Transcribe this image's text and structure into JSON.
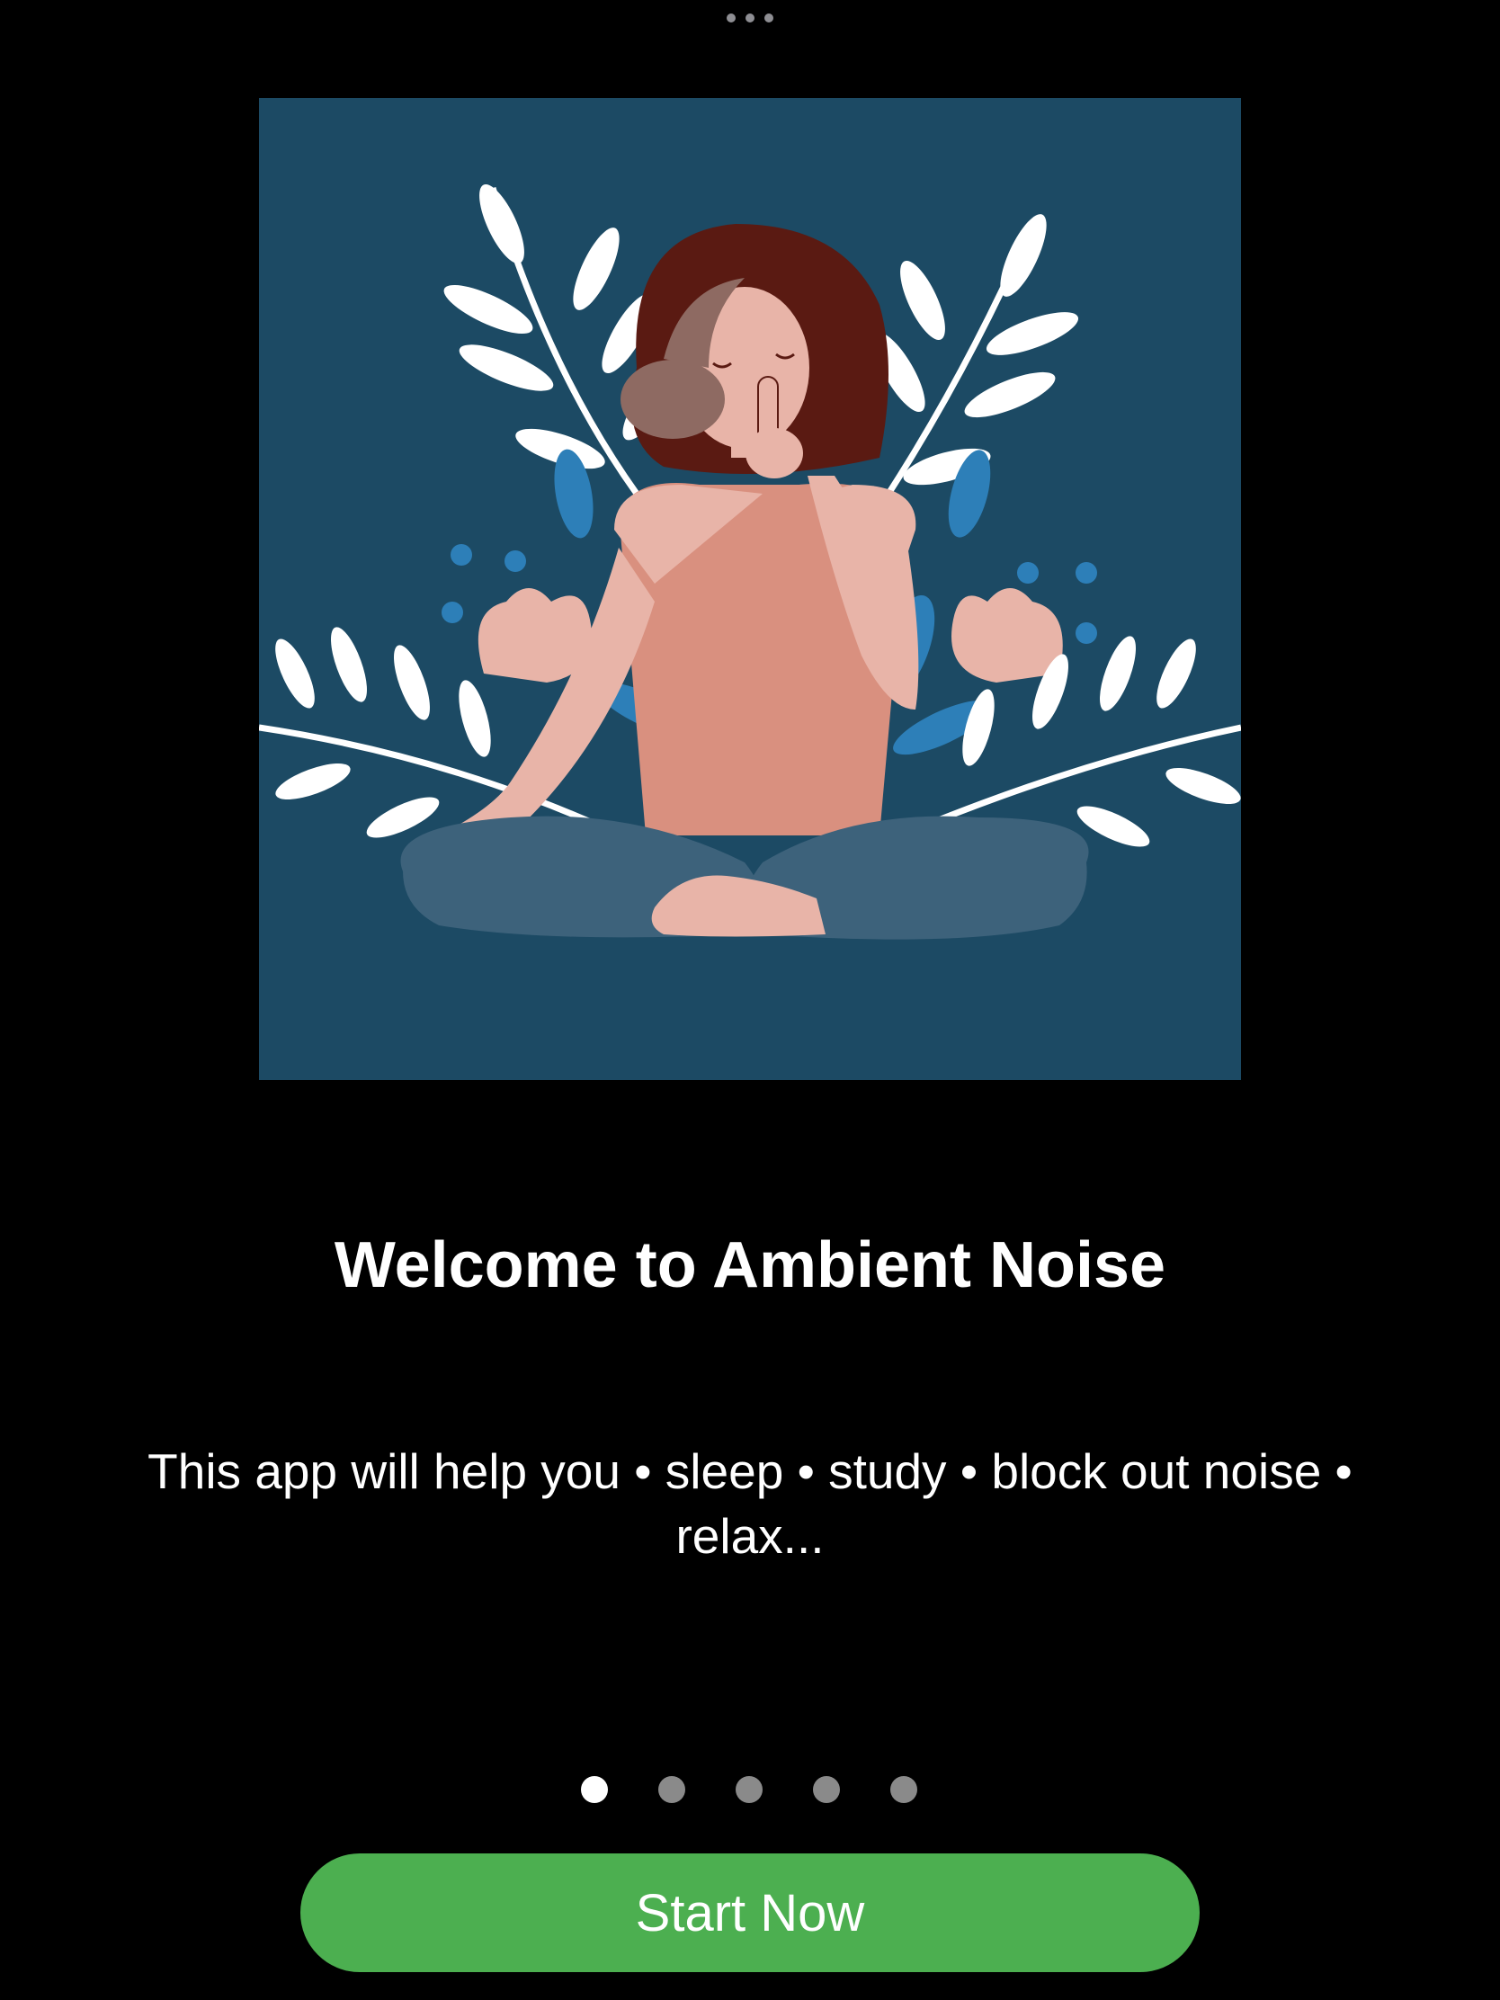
{
  "window": {
    "handle_icon": "more-dots-icon"
  },
  "hero": {
    "illustration": "meditating-woman-illustration",
    "background_color": "#1c4a64"
  },
  "onboarding": {
    "title": "Welcome to Ambient Noise",
    "subtitle": "This app will help you • sleep • study • block out noise  •  relax...",
    "page_indicator": {
      "total_pages": 5,
      "current_page": 1
    },
    "start_button_label": "Start Now"
  },
  "colors": {
    "background": "#000000",
    "accent": "#4caf50",
    "dot_active": "#ffffff",
    "dot_inactive": "#8a8a8a"
  }
}
